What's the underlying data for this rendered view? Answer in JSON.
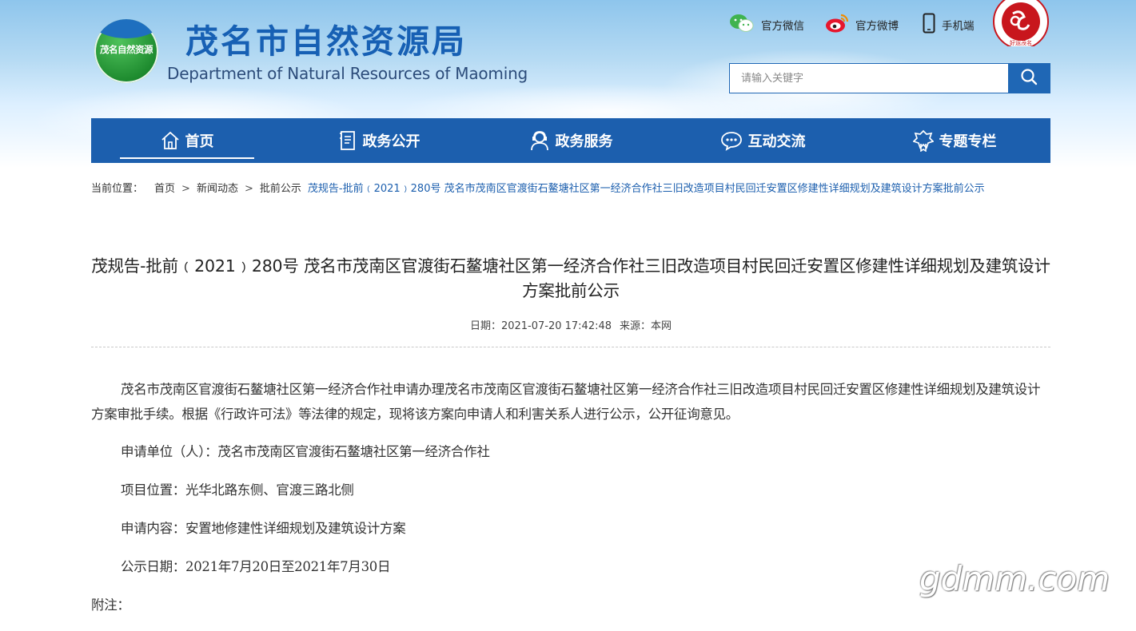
{
  "header": {
    "logo_text": "茂名自然资源",
    "title": "茂名市自然资源局",
    "subtitle": "Department of Natural Resources of Maoming",
    "links": [
      {
        "label": "官方微信",
        "icon": "wechat-icon"
      },
      {
        "label": "官方微博",
        "icon": "weibo-icon"
      },
      {
        "label": "手机端",
        "icon": "mobile-icon"
      }
    ],
    "seal_text": "HAOYUN MAOMING",
    "seal_caption": "好运茂名",
    "search_placeholder": "请输入关键字"
  },
  "nav": [
    {
      "label": "首页",
      "icon": "home-icon",
      "active": true
    },
    {
      "label": "政务公开",
      "icon": "document-icon",
      "active": false
    },
    {
      "label": "政务服务",
      "icon": "service-person-icon",
      "active": false
    },
    {
      "label": "互动交流",
      "icon": "chat-icon",
      "active": false
    },
    {
      "label": "专题专栏",
      "icon": "badge-icon",
      "active": false
    }
  ],
  "breadcrumb": {
    "prefix": "当前位置：",
    "items": [
      "首页",
      "新闻动态",
      "批前公示"
    ],
    "current": "茂规告-批前﹙2021﹚280号 茂名市茂南区官渡街石鳌塘社区第一经济合作社三旧改造项目村民回迁安置区修建性详细规划及建筑设计方案批前公示"
  },
  "article": {
    "title": "茂规告-批前﹙2021﹚280号 茂名市茂南区官渡街石鳌塘社区第一经济合作社三旧改造项目村民回迁安置区修建性详细规划及建筑设计方案批前公示",
    "date_label": "日期：",
    "date": "2021-07-20 17:42:48",
    "source_label": "来源：",
    "source": "本网",
    "intro": "茂名市茂南区官渡街石鳌塘社区第一经济合作社申请办理茂名市茂南区官渡街石鳌塘社区第一经济合作社三旧改造项目村民回迁安置区修建性详细规划及建筑设计方案审批手续。根据《行政许可法》等法律的规定，现将该方案向申请人和利害关系人进行公示，公开征询意见。",
    "applicant": "申请单位（人）：茂名市茂南区官渡街石鳌塘社区第一经济合作社",
    "location": "项目位置：光华北路东侧、官渡三路北侧",
    "content": "申请内容：安置地修建性详细规划及建筑设计方案",
    "period": "公示日期：2021年7月20日至2021年7月30日",
    "note": "附注："
  },
  "watermark": "gdmm.com",
  "colors": {
    "primary": "#1c5fae",
    "title_blue": "#1760b4"
  }
}
